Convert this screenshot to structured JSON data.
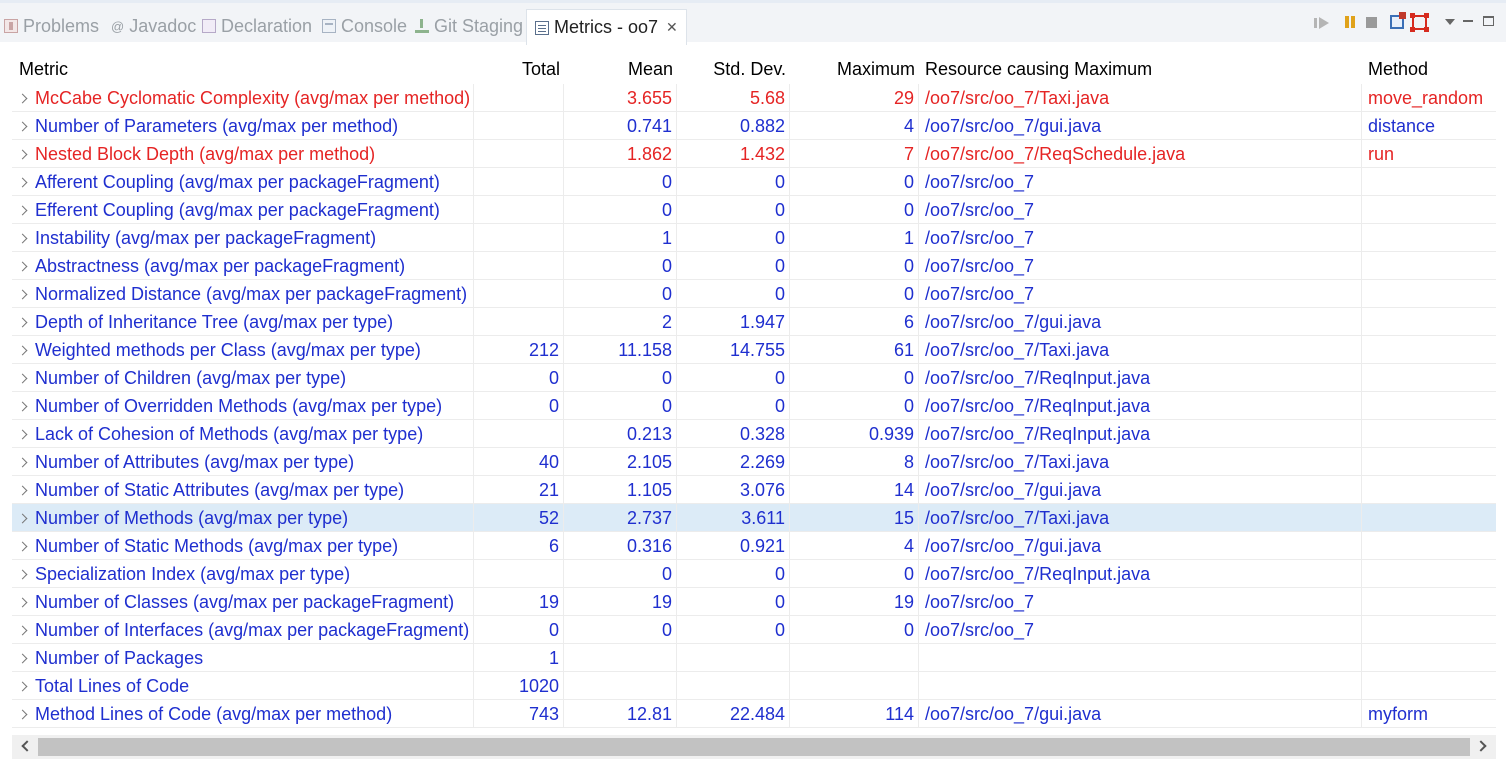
{
  "tabs": [
    {
      "label": "Problems",
      "icon": "problems-icon"
    },
    {
      "label": "Javadoc",
      "icon": "javadoc-icon"
    },
    {
      "label": "Declaration",
      "icon": "declaration-icon"
    },
    {
      "label": "Console",
      "icon": "console-icon"
    },
    {
      "label": "Git Staging",
      "icon": "git-staging-icon"
    },
    {
      "label": "Metrics - oo7",
      "icon": "metrics-icon",
      "active": true
    }
  ],
  "tab_close": "✕",
  "javadoc_glyph": "@",
  "columns": [
    "Metric",
    "Total",
    "Mean",
    "Std. Dev.",
    "Maximum",
    "Resource causing Maximum",
    "Method"
  ],
  "rows": [
    {
      "metric": "McCabe Cyclomatic Complexity (avg/max per method)",
      "total": "",
      "mean": "3.655",
      "std": "5.68",
      "max": "29",
      "resource": "/oo7/src/oo_7/Taxi.java",
      "method": "move_random"
    },
    {
      "metric": "Number of Parameters (avg/max per method)",
      "total": "",
      "mean": "0.741",
      "std": "0.882",
      "max": "4",
      "resource": "/oo7/src/oo_7/gui.java",
      "method": "distance"
    },
    {
      "metric": "Nested Block Depth (avg/max per method)",
      "total": "",
      "mean": "1.862",
      "std": "1.432",
      "max": "7",
      "resource": "/oo7/src/oo_7/ReqSchedule.java",
      "method": "run"
    },
    {
      "metric": "Afferent Coupling (avg/max per packageFragment)",
      "total": "",
      "mean": "0",
      "std": "0",
      "max": "0",
      "resource": "/oo7/src/oo_7",
      "method": ""
    },
    {
      "metric": "Efferent Coupling (avg/max per packageFragment)",
      "total": "",
      "mean": "0",
      "std": "0",
      "max": "0",
      "resource": "/oo7/src/oo_7",
      "method": ""
    },
    {
      "metric": "Instability (avg/max per packageFragment)",
      "total": "",
      "mean": "1",
      "std": "0",
      "max": "1",
      "resource": "/oo7/src/oo_7",
      "method": ""
    },
    {
      "metric": "Abstractness (avg/max per packageFragment)",
      "total": "",
      "mean": "0",
      "std": "0",
      "max": "0",
      "resource": "/oo7/src/oo_7",
      "method": ""
    },
    {
      "metric": "Normalized Distance (avg/max per packageFragment)",
      "total": "",
      "mean": "0",
      "std": "0",
      "max": "0",
      "resource": "/oo7/src/oo_7",
      "method": ""
    },
    {
      "metric": "Depth of Inheritance Tree (avg/max per type)",
      "total": "",
      "mean": "2",
      "std": "1.947",
      "max": "6",
      "resource": "/oo7/src/oo_7/gui.java",
      "method": ""
    },
    {
      "metric": "Weighted methods per Class (avg/max per type)",
      "total": "212",
      "mean": "11.158",
      "std": "14.755",
      "max": "61",
      "resource": "/oo7/src/oo_7/Taxi.java",
      "method": ""
    },
    {
      "metric": "Number of Children (avg/max per type)",
      "total": "0",
      "mean": "0",
      "std": "0",
      "max": "0",
      "resource": "/oo7/src/oo_7/ReqInput.java",
      "method": ""
    },
    {
      "metric": "Number of Overridden Methods (avg/max per type)",
      "total": "0",
      "mean": "0",
      "std": "0",
      "max": "0",
      "resource": "/oo7/src/oo_7/ReqInput.java",
      "method": ""
    },
    {
      "metric": "Lack of Cohesion of Methods (avg/max per type)",
      "total": "",
      "mean": "0.213",
      "std": "0.328",
      "max": "0.939",
      "resource": "/oo7/src/oo_7/ReqInput.java",
      "method": ""
    },
    {
      "metric": "Number of Attributes (avg/max per type)",
      "total": "40",
      "mean": "2.105",
      "std": "2.269",
      "max": "8",
      "resource": "/oo7/src/oo_7/Taxi.java",
      "method": ""
    },
    {
      "metric": "Number of Static Attributes (avg/max per type)",
      "total": "21",
      "mean": "1.105",
      "std": "3.076",
      "max": "14",
      "resource": "/oo7/src/oo_7/gui.java",
      "method": ""
    },
    {
      "metric": "Number of Methods (avg/max per type)",
      "total": "52",
      "mean": "2.737",
      "std": "3.611",
      "max": "15",
      "resource": "/oo7/src/oo_7/Taxi.java",
      "method": ""
    },
    {
      "metric": "Number of Static Methods (avg/max per type)",
      "total": "6",
      "mean": "0.316",
      "std": "0.921",
      "max": "4",
      "resource": "/oo7/src/oo_7/gui.java",
      "method": ""
    },
    {
      "metric": "Specialization Index (avg/max per type)",
      "total": "",
      "mean": "0",
      "std": "0",
      "max": "0",
      "resource": "/oo7/src/oo_7/ReqInput.java",
      "method": ""
    },
    {
      "metric": "Number of Classes (avg/max per packageFragment)",
      "total": "19",
      "mean": "19",
      "std": "0",
      "max": "19",
      "resource": "/oo7/src/oo_7",
      "method": ""
    },
    {
      "metric": "Number of Interfaces (avg/max per packageFragment)",
      "total": "0",
      "mean": "0",
      "std": "0",
      "max": "0",
      "resource": "/oo7/src/oo_7",
      "method": ""
    },
    {
      "metric": "Number of Packages",
      "total": "1",
      "mean": "",
      "std": "",
      "max": "",
      "resource": "",
      "method": ""
    },
    {
      "metric": "Total Lines of Code",
      "total": "1020",
      "mean": "",
      "std": "",
      "max": "",
      "resource": "",
      "method": ""
    },
    {
      "metric": "Method Lines of Code (avg/max per method)",
      "total": "743",
      "mean": "12.81",
      "std": "22.484",
      "max": "114",
      "resource": "/oo7/src/oo_7/gui.java",
      "method": "myform"
    }
  ],
  "warning_rows": [
    0,
    2
  ],
  "selected_row": 15,
  "colors": {
    "text_normal": "#1f2fcf",
    "text_warning": "#e52424",
    "selection": "#dcebf7"
  }
}
